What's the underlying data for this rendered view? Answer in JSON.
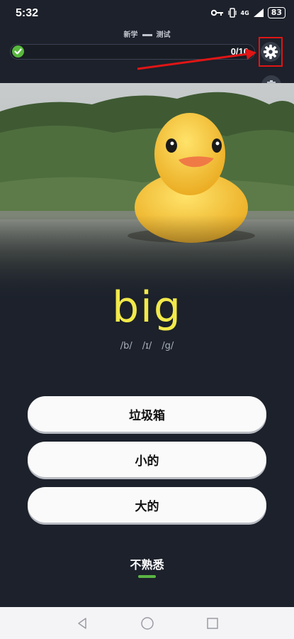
{
  "status_bar": {
    "time": "5:32",
    "network": "4G",
    "battery": "83"
  },
  "header": {
    "mode_left": "新学",
    "mode_right": "测试"
  },
  "progress": {
    "text": "0/10",
    "fraction": 0.0
  },
  "word": {
    "text": "big",
    "phonetics": [
      "/b/",
      "/ɪ/",
      "/g/"
    ]
  },
  "options": [
    {
      "label": "垃圾箱"
    },
    {
      "label": "小的"
    },
    {
      "label": "大的"
    }
  ],
  "unfamiliar_label": "不熟悉",
  "colors": {
    "background": "#1c212b",
    "word": "#f2e94a",
    "accent": "#5bb544",
    "annotation": "#e01515"
  },
  "icons": [
    "check-icon",
    "gear-icon",
    "trash-icon",
    "back-icon",
    "home-icon",
    "recents-icon"
  ]
}
